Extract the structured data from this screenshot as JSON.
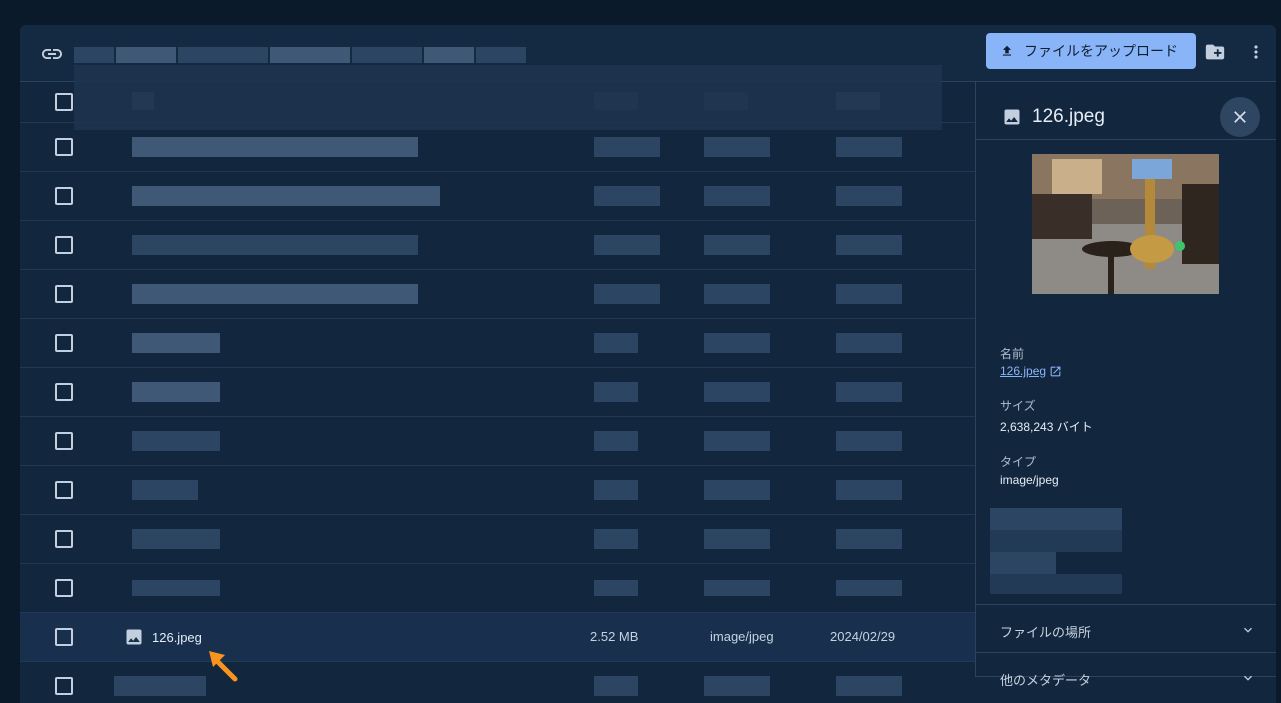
{
  "toolbar": {
    "upload_label": "ファイルをアップロード"
  },
  "selected_row": {
    "name": "126.jpeg",
    "size": "2.52 MB",
    "type": "image/jpeg",
    "date": "2024/02/29"
  },
  "details": {
    "title": "126.jpeg",
    "name_label": "名前",
    "name_value": "126.jpeg",
    "size_label": "サイズ",
    "size_value": "2,638,243 バイト",
    "type_label": "タイプ",
    "type_value": "image/jpeg",
    "location_label": "ファイルの場所",
    "metadata_label": "他のメタデータ"
  },
  "colors": {
    "background": "#0b1a2b",
    "panel": "#12263d",
    "accent": "#8ab4f8",
    "annotation_arrow": "#f7931e"
  },
  "icons": [
    "link-icon",
    "upload-icon",
    "new-folder-icon",
    "more-vert-icon",
    "image-icon",
    "close-icon",
    "open-in-new-icon",
    "chevron-down-icon"
  ]
}
